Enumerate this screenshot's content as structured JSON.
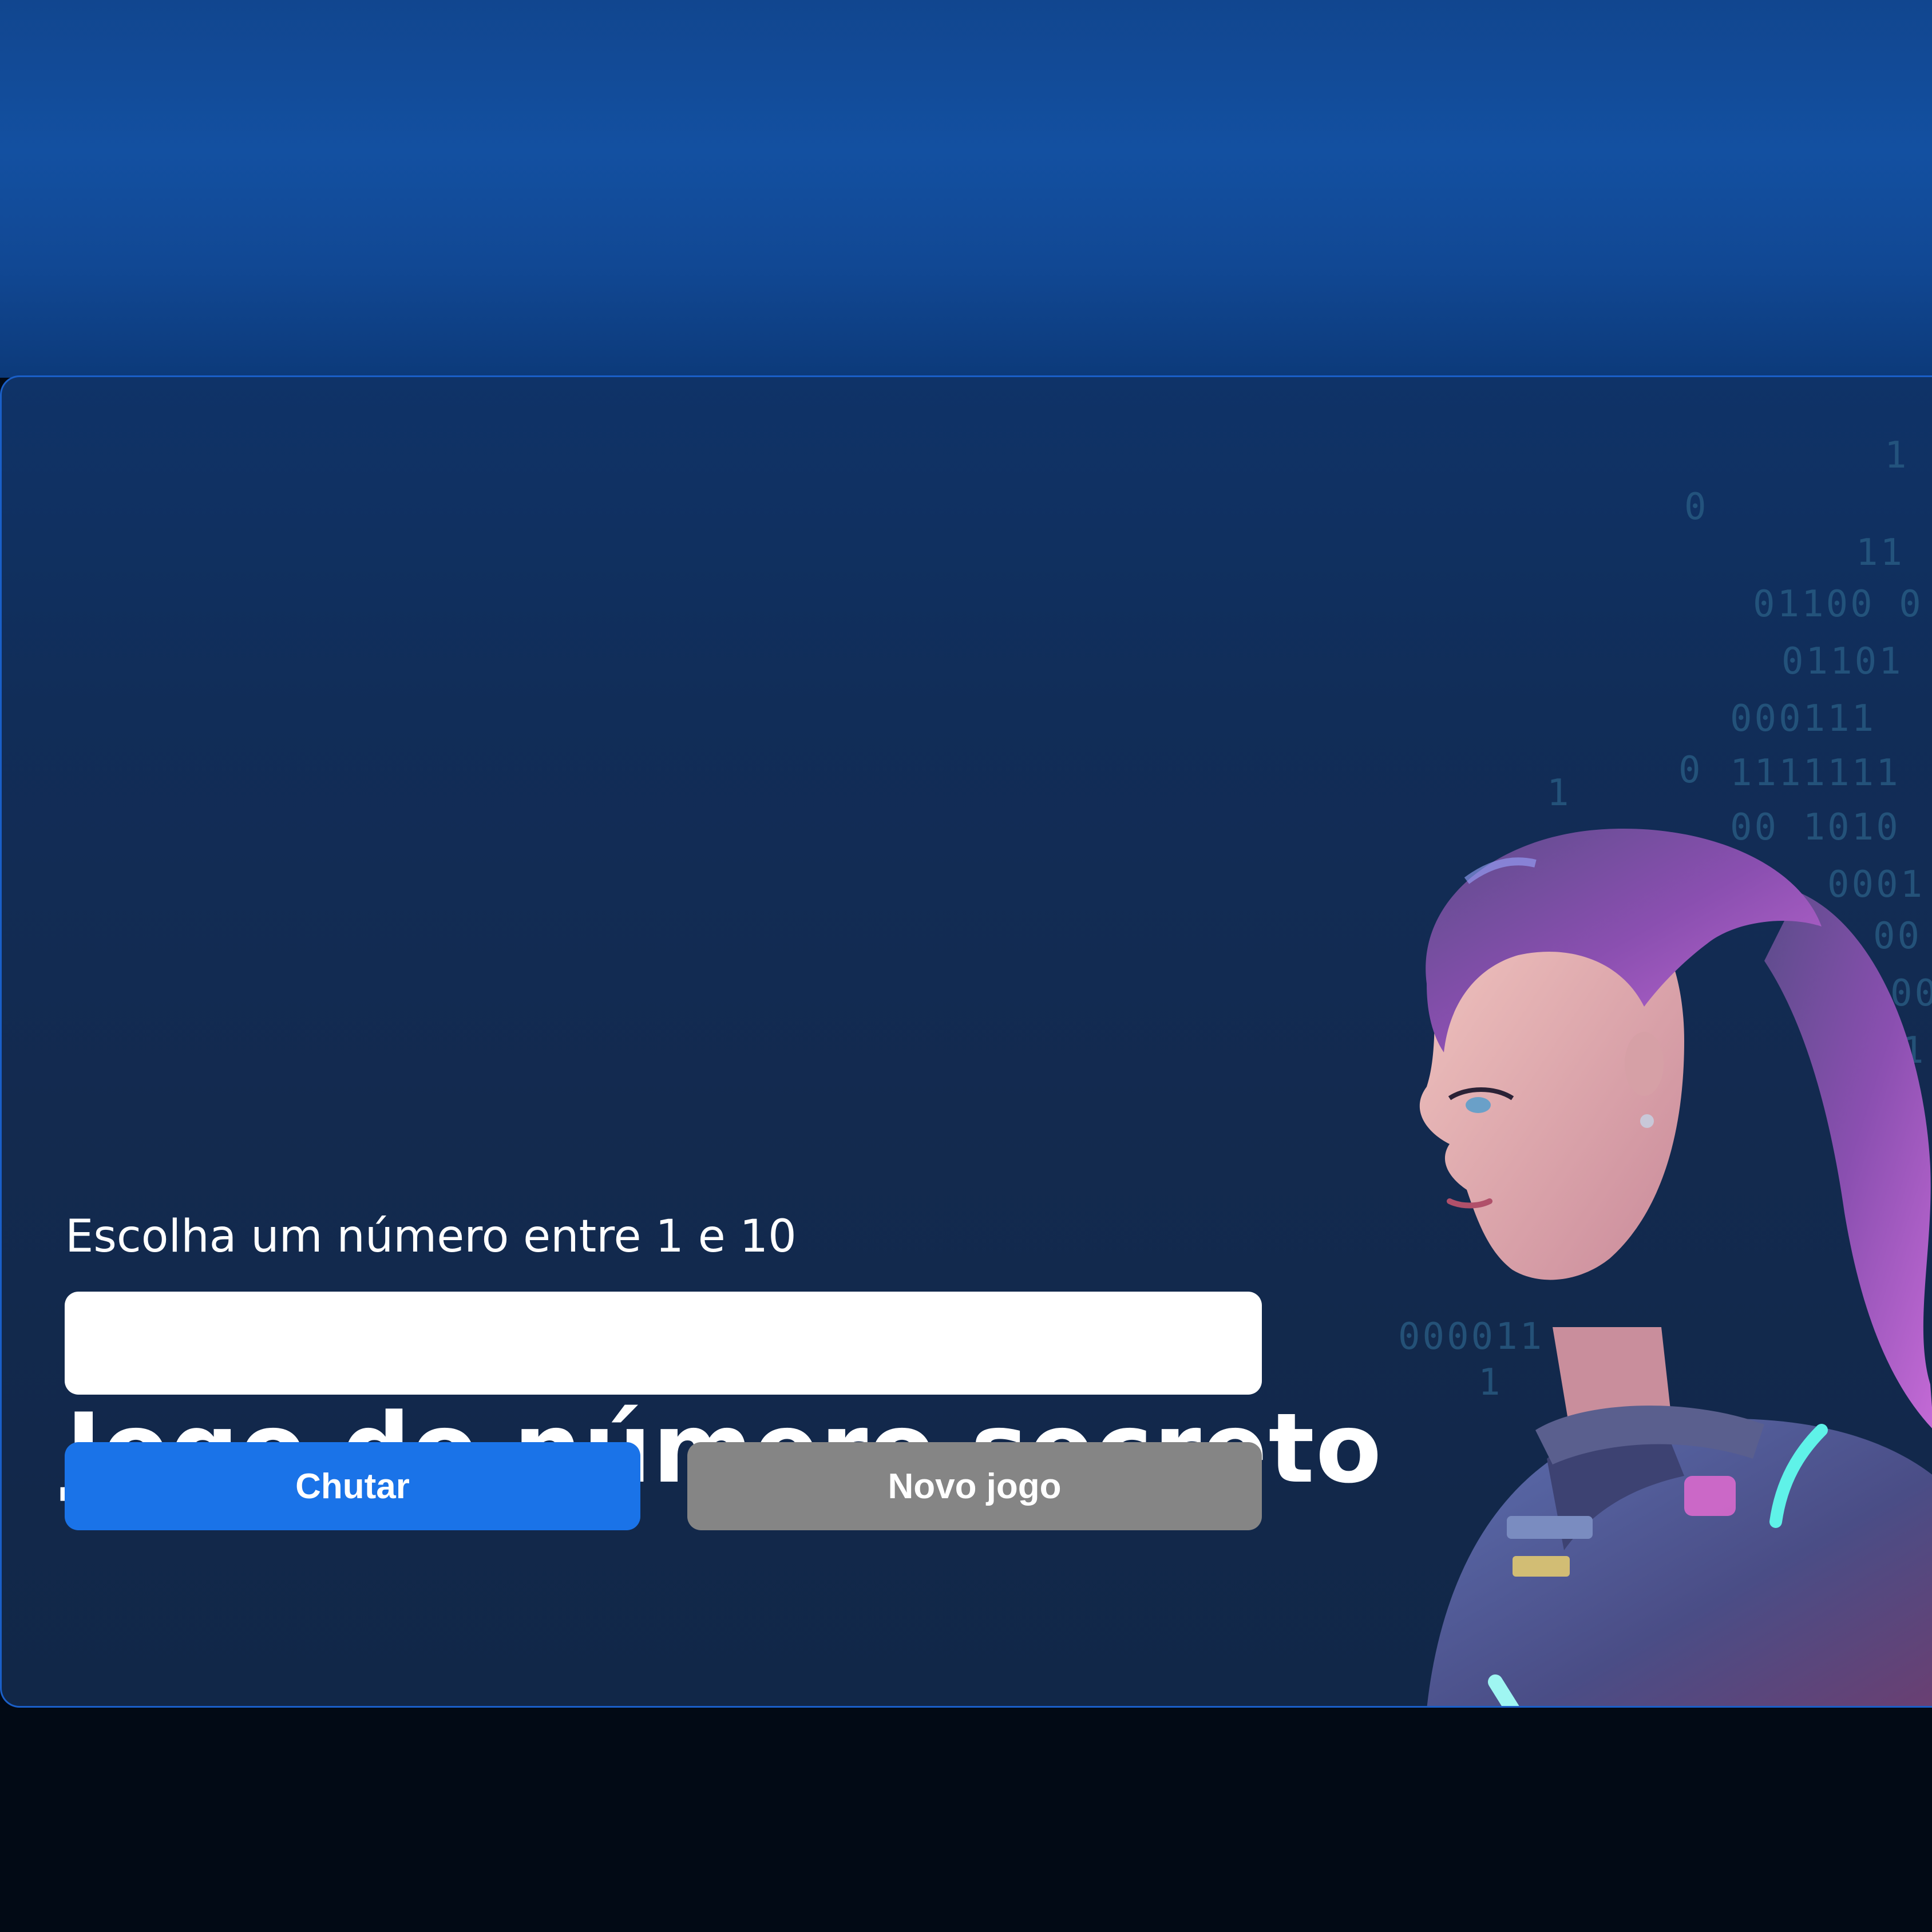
{
  "page": {
    "title": "Jogo do número secreto",
    "prompt": "Escolha um número entre 1 e 10",
    "input": {
      "value": "",
      "placeholder": ""
    },
    "buttons": {
      "guess": "Chutar",
      "new_game": "Novo jogo"
    }
  },
  "colors": {
    "background_top": "#1350a1",
    "card": "#132a4f",
    "card_border": "#1a5fc8",
    "primary_button": "#1a73e8",
    "secondary_button": "#858585",
    "text": "#ffffff"
  }
}
